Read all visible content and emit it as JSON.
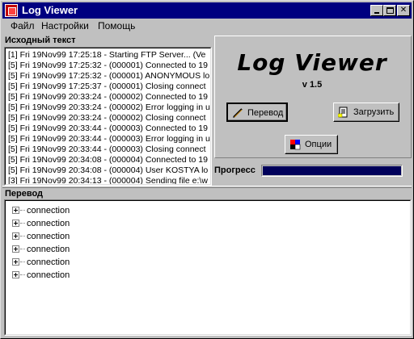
{
  "window": {
    "title": "Log Viewer"
  },
  "menu": [
    "Файл",
    "Настройки",
    "Помощь"
  ],
  "source_panel": {
    "label": "Исходный текст",
    "lines": [
      "[1] Fri 19Nov99 17:25:18 - Starting FTP Server...  (Ve",
      "[5] Fri 19Nov99 17:25:32 - (000001) Connected to 19",
      "[5] Fri 19Nov99 17:25:32 - (000001) ANONYMOUS lo",
      "[5] Fri 19Nov99 17:25:37 - (000001) Closing connect",
      "[5] Fri 19Nov99 20:33:24 - (000002) Connected to 19",
      "[5] Fri 19Nov99 20:33:24 - (000002) Error logging in u",
      "[5] Fri 19Nov99 20:33:24 - (000002) Closing connect",
      "[5] Fri 19Nov99 20:33:44 - (000003) Connected to 19",
      "[5] Fri 19Nov99 20:33:44 - (000003) Error logging in u",
      "[5] Fri 19Nov99 20:33:44 - (000003) Closing connect",
      "[5] Fri 19Nov99 20:34:08 - (000004) Connected to 19",
      "[5] Fri 19Nov99 20:34:08 - (000004) User KOSTYA lo",
      "[3] Fri 19Nov99 20:34:13 - (000004) Sending file e:\\w"
    ]
  },
  "app_panel": {
    "logo": "Log Viewer",
    "version": "v 1.5",
    "translate_button": "Перевод",
    "load_button": "Загрузить",
    "options_button": "Опции",
    "progress_label": "Прогресс",
    "progress_value": 1.0
  },
  "translation_panel": {
    "label": "Перевод",
    "items": [
      "connection",
      "connection",
      "connection",
      "connection",
      "connection",
      "connection"
    ]
  },
  "icons": {
    "app": "log-viewer-app-icon",
    "translate": "pencil-icon",
    "load": "document-load-icon",
    "options": "options-palette-icon"
  },
  "colors": {
    "titlebar": "#000080",
    "progress_fill": "#00005a"
  }
}
